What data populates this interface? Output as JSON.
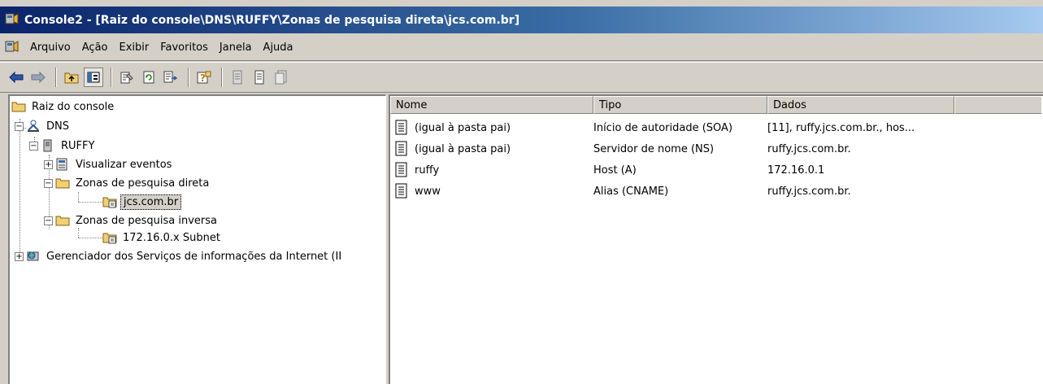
{
  "window": {
    "title": "Console2 - [Raiz do console\\DNS\\RUFFY\\Zonas de pesquisa direta\\jcs.com.br]"
  },
  "menu": {
    "items": [
      {
        "label": "Arquivo"
      },
      {
        "label": "Ação"
      },
      {
        "label": "Exibir"
      },
      {
        "label": "Favoritos"
      },
      {
        "label": "Janela"
      },
      {
        "label": "Ajuda"
      }
    ]
  },
  "toolbar": {
    "buttons": [
      "back-icon",
      "forward-icon",
      "up-folder-icon",
      "show-hide-tree-icon",
      "properties-icon",
      "refresh-icon",
      "export-list-icon",
      "help-icon",
      "new-record-icon",
      "new-host-icon",
      "new-alias-icon"
    ]
  },
  "tree": {
    "root": "Raiz do console",
    "dns": "DNS",
    "server": "RUFFY",
    "events": "Visualizar eventos",
    "forward": "Zonas de pesquisa direta",
    "zone": "jcs.com.br",
    "reverse": "Zonas de pesquisa inversa",
    "subnet": "172.16.0.x Subnet",
    "iis": "Gerenciador dos Serviços de informações da Internet (II"
  },
  "list": {
    "columns": [
      "Nome",
      "Tipo",
      "Dados"
    ],
    "rows": [
      {
        "name": "(igual à pasta pai)",
        "type": "Início de autoridade (SOA)",
        "data": "[11], ruffy.jcs.com.br., hos..."
      },
      {
        "name": "(igual à pasta pai)",
        "type": "Servidor de nome (NS)",
        "data": "ruffy.jcs.com.br."
      },
      {
        "name": "ruffy",
        "type": "Host (A)",
        "data": "172.16.0.1"
      },
      {
        "name": "www",
        "type": "Alias (CNAME)",
        "data": "ruffy.jcs.com.br."
      }
    ]
  },
  "colors": {
    "title_start": "#0a246a",
    "title_end": "#a6caf0",
    "face": "#d4d0c8"
  }
}
